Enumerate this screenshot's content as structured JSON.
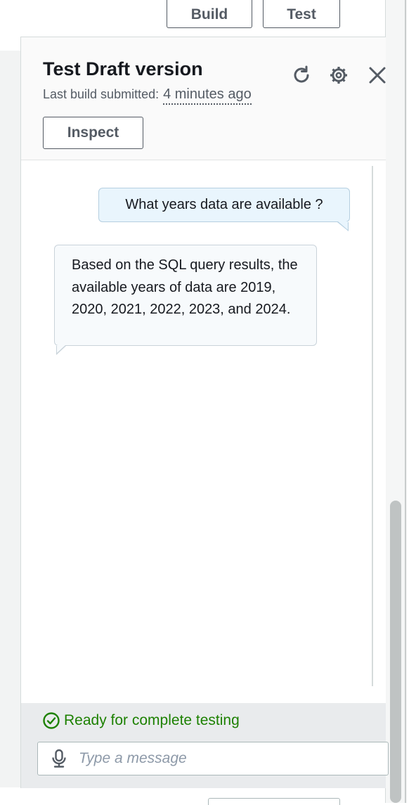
{
  "top_modes": {
    "build_label": "Build",
    "test_label": "Test"
  },
  "panel": {
    "title": "Test Draft version",
    "build_info_label": "Last build submitted:",
    "build_info_time": "4 minutes ago",
    "inspect_label": "Inspect",
    "icons": [
      "refresh-icon",
      "settings-icon",
      "close-icon"
    ]
  },
  "messages": [
    {
      "role": "user",
      "text": "What years data are available ?"
    },
    {
      "role": "bot",
      "text": "Based on the SQL query results, the available years of data are 2019, 2020, 2021, 2022, 2023, and 2024."
    }
  ],
  "footer": {
    "status_text": "Ready for complete testing",
    "status_color": "#1d8102",
    "input_placeholder": "Type a message"
  }
}
